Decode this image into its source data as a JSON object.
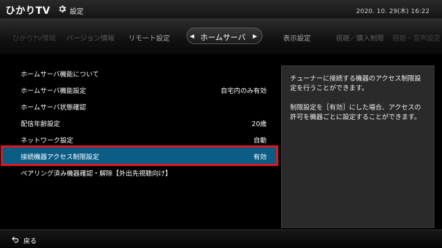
{
  "header": {
    "logo": "ひかりTV",
    "title": "設定",
    "datetime": "2020. 10. 29(木)  16:22"
  },
  "tabs": {
    "items": [
      "ひかりTV情報",
      "バージョン情報",
      "リモート設定",
      "ホームサーバ",
      "表示設定",
      "視聴／購入制限",
      "視聴・音声設定"
    ],
    "active": "ホームサーバ"
  },
  "menu": [
    {
      "label": "ホームサーバ機能について",
      "value": ""
    },
    {
      "label": "ホームサーバ機能設定",
      "value": "自宅内のみ有効"
    },
    {
      "label": "ホームサーバ状態確認",
      "value": ""
    },
    {
      "label": "配信年齢設定",
      "value": "20歳"
    },
    {
      "label": "ネットワーク設定",
      "value": "自動"
    },
    {
      "label": "接続機器アクセス制限設定",
      "value": "有効"
    },
    {
      "label": "ペアリング済み機器確認・解除【外出先視聴向け】",
      "value": ""
    }
  ],
  "description": {
    "p1": "チューナーに接続する機器のアクセス制限設定を行うことができます。",
    "p2": "制限設定を［有効］にした場合、アクセスの許可を機器ごとに設定することができます。"
  },
  "footer": {
    "back_label": "戻る"
  },
  "colors": {
    "selected_bg": "#0c5d86",
    "highlight_border": "#e3151f"
  },
  "icons": {
    "settings": "gear-icon",
    "back": "back-arrow-icon",
    "prev": "left-arrow-icon",
    "next": "right-arrow-icon"
  }
}
